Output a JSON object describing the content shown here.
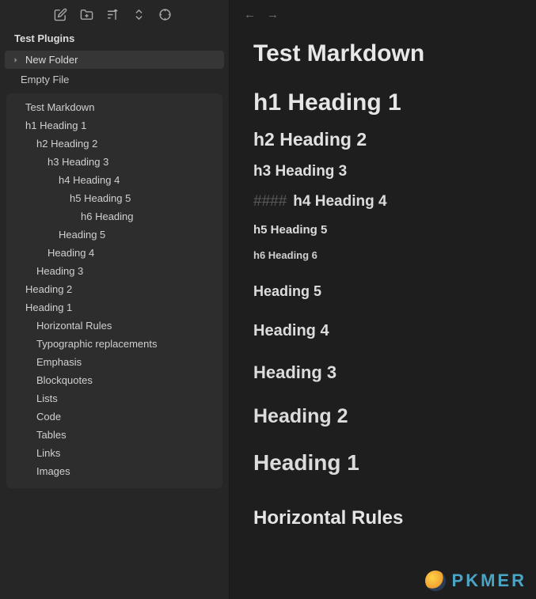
{
  "vault_title": "Test Plugins",
  "folder": {
    "name": "New Folder"
  },
  "file": {
    "name": "Empty File"
  },
  "outline": {
    "title": "Test Markdown",
    "items": [
      {
        "label": "h1 Heading 1",
        "indent": 1
      },
      {
        "label": "h2 Heading 2",
        "indent": 2
      },
      {
        "label": "h3 Heading 3",
        "indent": 3
      },
      {
        "label": "h4 Heading 4",
        "indent": 4
      },
      {
        "label": "h5 Heading 5",
        "indent": 5
      },
      {
        "label": "h6 Heading",
        "indent": 6
      },
      {
        "label": "Heading 5",
        "indent": 4
      },
      {
        "label": "Heading 4",
        "indent": 3
      },
      {
        "label": "Heading 3",
        "indent": 2
      },
      {
        "label": "Heading 2",
        "indent": 1
      },
      {
        "label": "Heading 1",
        "indent": 1
      },
      {
        "label": "Horizontal Rules",
        "indent": 2
      },
      {
        "label": "Typographic replacements",
        "indent": 2
      },
      {
        "label": "Emphasis",
        "indent": 2
      },
      {
        "label": "Blockquotes",
        "indent": 2
      },
      {
        "label": "Lists",
        "indent": 2
      },
      {
        "label": "Code",
        "indent": 2
      },
      {
        "label": "Tables",
        "indent": 2
      },
      {
        "label": "Links",
        "indent": 2
      },
      {
        "label": "Images",
        "indent": 2
      }
    ]
  },
  "doc": {
    "title": "Test Markdown",
    "h1": "h1 Heading 1",
    "h2": "h2 Heading 2",
    "h3": "h3 Heading 3",
    "h4_hashes": "####",
    "h4": "h4 Heading 4",
    "h5": "h5 Heading 5",
    "h6": "h6 Heading 6",
    "sec_h5": "Heading 5",
    "sec_h4": "Heading 4",
    "sec_h3": "Heading 3",
    "sec_h2": "Heading 2",
    "sec_h1": "Heading 1",
    "hr_title": "Horizontal Rules"
  },
  "nav": {
    "back": "←",
    "forward": "→"
  },
  "watermark": "PKMER"
}
